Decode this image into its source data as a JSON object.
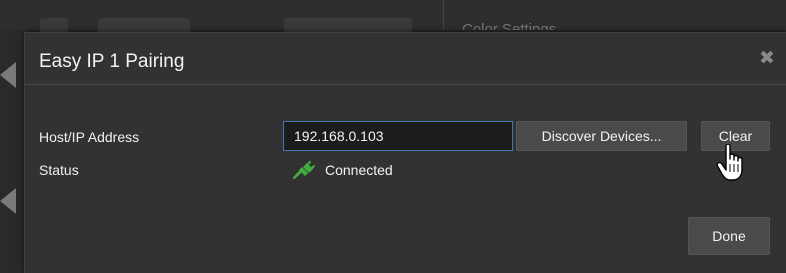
{
  "background": {
    "heading": "Color Settings"
  },
  "dialog": {
    "title": "Easy IP 1 Pairing",
    "close_icon": "close-icon",
    "fields": {
      "host_label": "Host/IP Address",
      "host_value": "192.168.0.103",
      "status_label": "Status",
      "status_value": "Connected",
      "status_icon": "plug-icon",
      "status_color": "#3fae3f"
    },
    "buttons": {
      "discover_label": "Discover Devices...",
      "clear_label": "Clear",
      "done_label": "Done"
    }
  },
  "colors": {
    "input_border": "#3d7ab3",
    "dialog_bg": "#323232"
  }
}
